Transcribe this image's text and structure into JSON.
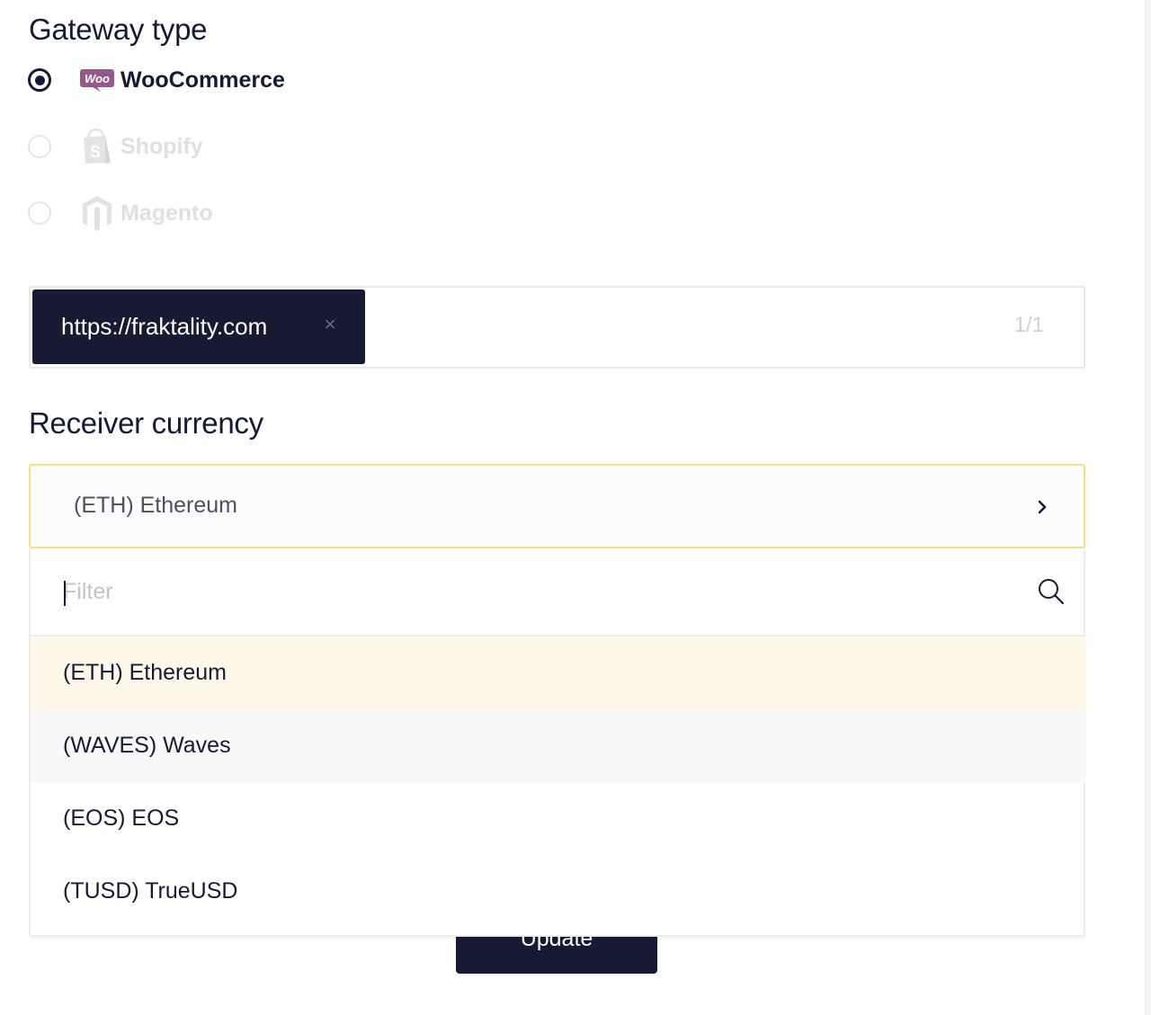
{
  "gateway": {
    "heading": "Gateway type",
    "options": [
      {
        "label": "WooCommerce",
        "logo_text": "Woo",
        "icon": "woocommerce-logo",
        "checked": true,
        "disabled": false
      },
      {
        "label": "Shopify",
        "logo_text": "S",
        "icon": "shopify-logo",
        "checked": false,
        "disabled": true
      },
      {
        "label": "Magento",
        "icon": "magento-logo",
        "checked": false,
        "disabled": true
      }
    ]
  },
  "urls": {
    "tag": "https://fraktality.com",
    "remove_icon": "close-icon",
    "counter": "1/1"
  },
  "receiver": {
    "heading": "Receiver currency",
    "selected": "(ETH) Ethereum",
    "chevron_icon": "chevron-right-icon",
    "filter_placeholder": "Filter",
    "filter_value": "",
    "search_icon": "search-icon",
    "options": [
      {
        "label": "(ETH) Ethereum",
        "state": "selected"
      },
      {
        "label": "(WAVES) Waves",
        "state": "hovered"
      },
      {
        "label": "(EOS) EOS",
        "state": "normal"
      },
      {
        "label": "(TUSD) TrueUSD",
        "state": "normal"
      }
    ]
  },
  "update_button": {
    "label": "Update"
  },
  "colors": {
    "primary": "#161b33",
    "focus_border": "#f6e27d",
    "selected_option": "#fdf8ea",
    "hover_option": "#f8f8f8",
    "woo_purple": "#96588a",
    "disabled_text": "#e0e0e0"
  }
}
